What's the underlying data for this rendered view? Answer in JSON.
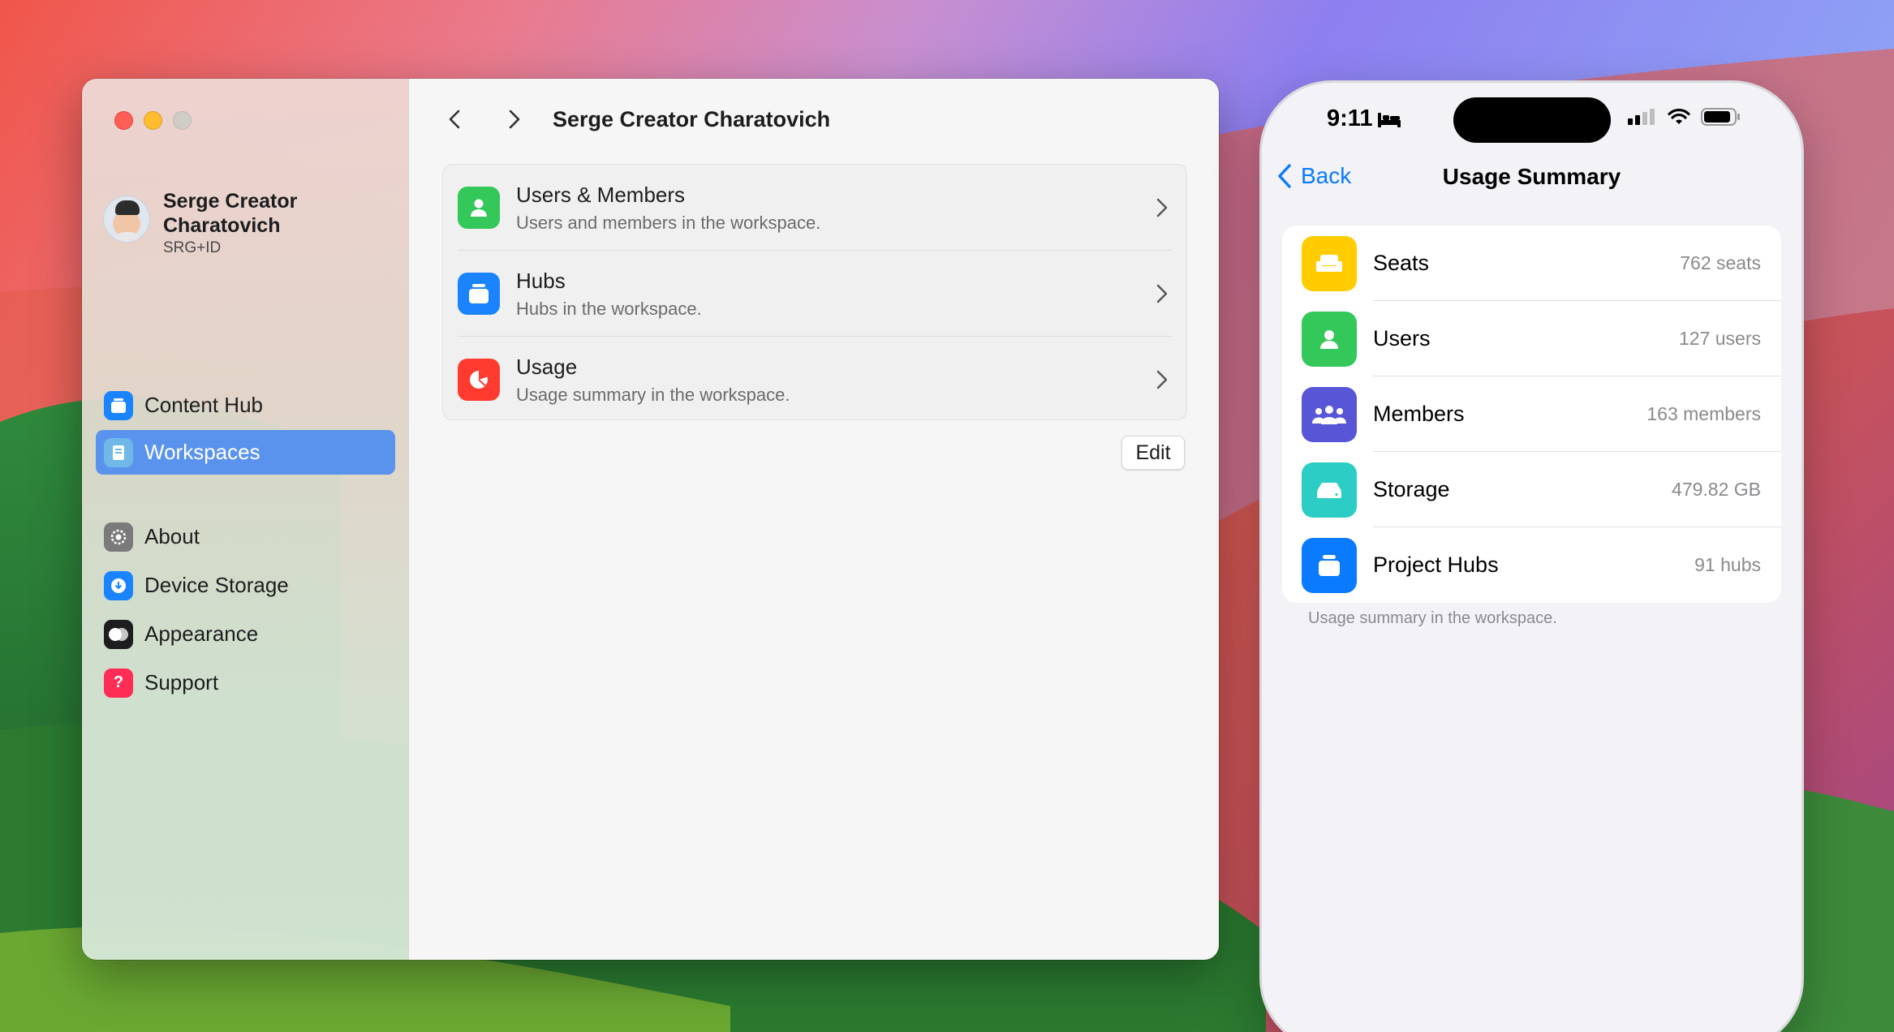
{
  "mac": {
    "sidebar": {
      "profile": {
        "name": "Serge Creator Charatovich",
        "id": "SRG+ID"
      },
      "items": [
        {
          "label": "Content Hub",
          "icon": "hub-icon",
          "color": "#1a84ff"
        },
        {
          "label": "Workspaces",
          "icon": "workspace-icon",
          "color": "#6fb8e8",
          "active": true
        },
        {
          "label": "About",
          "icon": "gear-icon",
          "color": "#7a7a7a"
        },
        {
          "label": "Device Storage",
          "icon": "download-icon",
          "color": "#1a84ff"
        },
        {
          "label": "Appearance",
          "icon": "appearance-icon",
          "color": "#1d1d1f"
        },
        {
          "label": "Support",
          "icon": "question-icon",
          "color": "#ff2d55"
        }
      ]
    },
    "content": {
      "title": "Serge Creator Charatovich",
      "rows": [
        {
          "title": "Users & Members",
          "subtitle": "Users and members in the workspace.",
          "icon": "person-icon",
          "color": "#34c759"
        },
        {
          "title": "Hubs",
          "subtitle": "Hubs in the workspace.",
          "icon": "hub-icon",
          "color": "#1a84ff"
        },
        {
          "title": "Usage",
          "subtitle": "Usage summary in the workspace.",
          "icon": "pie-chart-icon",
          "color": "#ff3b30"
        }
      ],
      "edit_label": "Edit"
    }
  },
  "phone": {
    "status": {
      "time": "9:11"
    },
    "nav": {
      "back_label": "Back",
      "title": "Usage Summary"
    },
    "rows": [
      {
        "label": "Seats",
        "value": "762 seats",
        "icon": "seat-icon",
        "color": "#ffcc00"
      },
      {
        "label": "Users",
        "value": "127 users",
        "icon": "person-icon",
        "color": "#34c759"
      },
      {
        "label": "Members",
        "value": "163 members",
        "icon": "group-icon",
        "color": "#5856d6"
      },
      {
        "label": "Storage",
        "value": "479.82 GB",
        "icon": "drive-icon",
        "color": "#2ccdc4"
      },
      {
        "label": "Project Hubs",
        "value": "91 hubs",
        "icon": "hub-icon",
        "color": "#0a7aff"
      }
    ],
    "footer": "Usage summary in the workspace."
  }
}
